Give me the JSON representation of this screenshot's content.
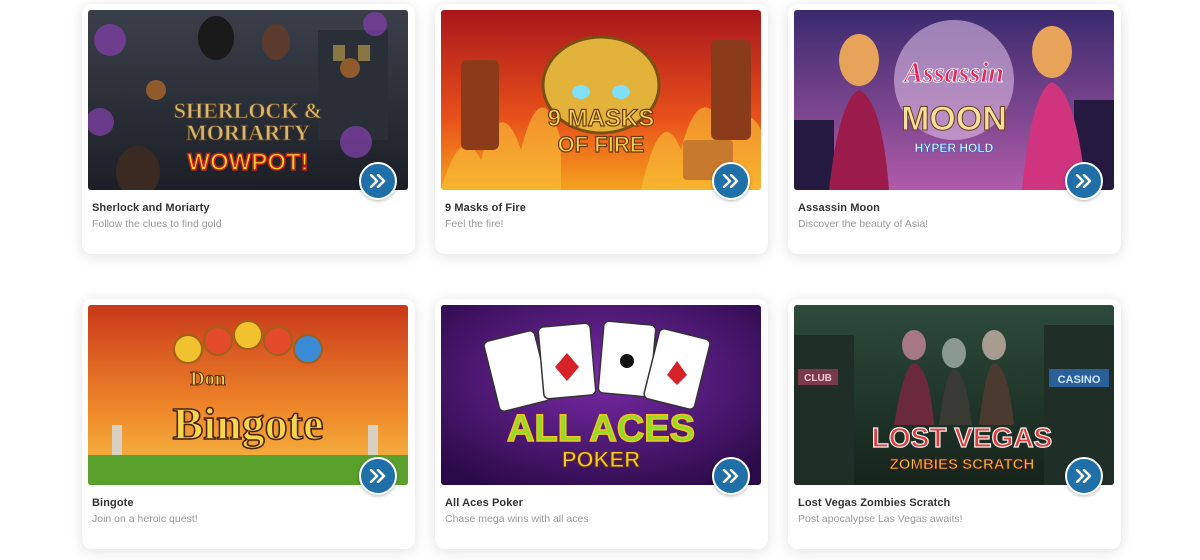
{
  "games": [
    {
      "title": "Sherlock and Moriarty",
      "subtitle": "Follow the clues to find gold",
      "logo_line1": "SHERLOCK &",
      "logo_line2": "MORIARTY",
      "logo_line3": "WOWPOT!"
    },
    {
      "title": "9 Masks of Fire",
      "subtitle": "Feel the fire!",
      "logo_line1": "9 MASKS",
      "logo_line2": "OF FIRE"
    },
    {
      "title": "Assassin Moon",
      "subtitle": "Discover the beauty of Asia!",
      "logo_line1": "Assassin",
      "logo_line2": "MOON",
      "logo_line3": "HYPER HOLD"
    },
    {
      "title": "Bingote",
      "subtitle": "Join on a heroic quest!",
      "logo_line1": "Don",
      "logo_line2": "Bingote"
    },
    {
      "title": "All Aces Poker",
      "subtitle": "Chase mega wins with all aces",
      "logo_line1": "ALL ACES",
      "logo_line2": "POKER"
    },
    {
      "title": "Lost Vegas Zombies Scratch",
      "subtitle": "Post apocalypse Las Vegas awaits!",
      "logo_line1": "LOST VEGAS",
      "logo_line2": "ZOMBIES SCRATCH",
      "sign_club": "CLUB",
      "sign_casino": "CASINO"
    }
  ],
  "play_icon": "double-chevron-right-icon",
  "colors": {
    "play_button": "#1f6fa8",
    "title": "#333333",
    "subtitle": "#9a9a9a"
  }
}
